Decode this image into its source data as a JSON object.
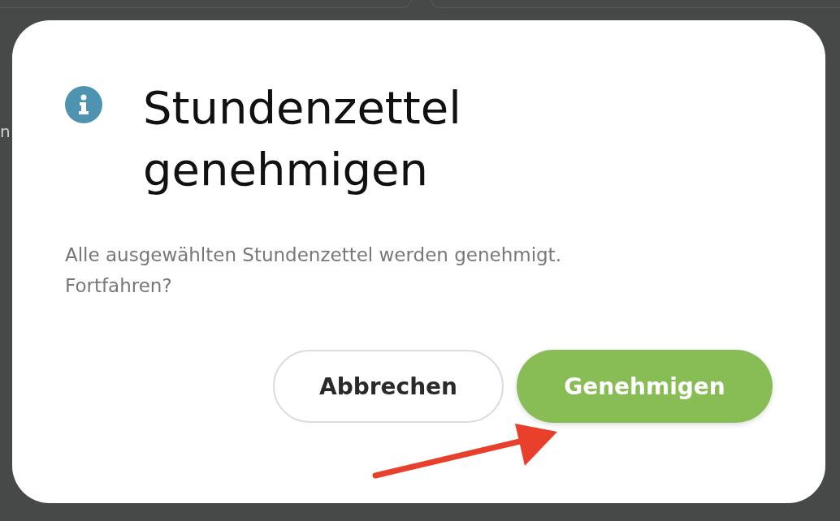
{
  "background": {
    "fragment": "n"
  },
  "dialog": {
    "title": "Stundenzettel genehmigen",
    "message": "Alle ausgewählten Stundenzettel werden genehmigt. Fortfahren?",
    "buttons": [
      {
        "label": "Abbrechen",
        "kind": "secondary"
      },
      {
        "label": "Genehmigen",
        "kind": "primary"
      }
    ]
  }
}
